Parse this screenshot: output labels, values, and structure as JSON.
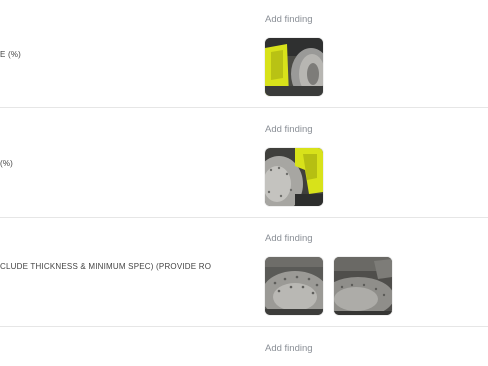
{
  "rows": [
    {
      "label": "E (%)",
      "add_finding": "Add finding",
      "photos": [
        "yellow-caliper-rotor-photo"
      ]
    },
    {
      "label": "(%)",
      "add_finding": "Add finding",
      "photos": [
        "yellow-caliper-rotor-photo"
      ]
    },
    {
      "label": "CLUDE THICKNESS & MINIMUM SPEC) (PROVIDE RO",
      "add_finding": "Add finding",
      "photos": [
        "drilled-rotor-photo",
        "rotor-edge-photo"
      ]
    },
    {
      "label": "",
      "add_finding": "Add finding",
      "photos": []
    }
  ],
  "colors": {
    "caliper": "#d8e21a",
    "link": "#8a8f96",
    "divider": "#e6e6e6"
  }
}
